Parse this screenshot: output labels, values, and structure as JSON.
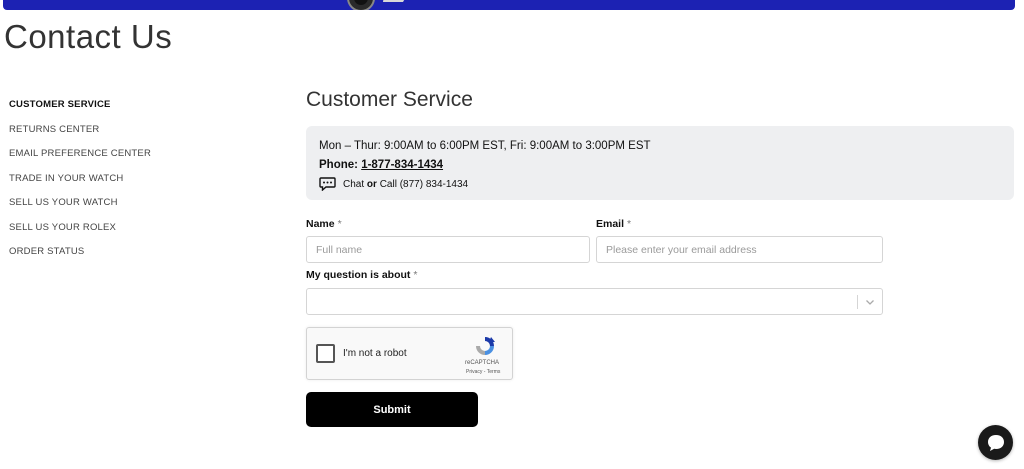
{
  "header": {
    "page_title": "Contact Us"
  },
  "sidebar": {
    "items": [
      {
        "label": "CUSTOMER SERVICE",
        "active": true
      },
      {
        "label": "RETURNS CENTER"
      },
      {
        "label": "EMAIL PREFERENCE CENTER"
      },
      {
        "label": "TRADE IN YOUR WATCH"
      },
      {
        "label": "SELL US YOUR WATCH"
      },
      {
        "label": "SELL US YOUR ROLEX"
      },
      {
        "label": "ORDER STATUS"
      }
    ]
  },
  "main": {
    "section_title": "Customer Service",
    "info": {
      "hours": "Mon – Thur: 9:00AM to 6:00PM EST, Fri: 9:00AM to 3:00PM EST",
      "phone_label": "Phone:",
      "phone_number": "1-877-834-1434",
      "chat_text": "Chat",
      "chat_or": "or",
      "call_text": "Call (877) 834-1434"
    },
    "form": {
      "name_label": "Name",
      "name_placeholder": "Full name",
      "name_value": "",
      "email_label": "Email",
      "email_placeholder": "Please enter your email address",
      "email_value": "",
      "question_label": "My question is about",
      "question_value": "",
      "required_mark": "*",
      "recaptcha_label": "I'm not a robot",
      "recaptcha_brand": "reCAPTCHA",
      "recaptcha_links": "Privacy - Terms",
      "submit_label": "Submit"
    }
  },
  "colors": {
    "banner": "#1c22b3",
    "info_bg": "#eeeff1",
    "button": "#000000"
  },
  "icons": [
    "chat-bubble-icon",
    "chevron-down-icon",
    "recaptcha-logo-icon",
    "chat-launcher-icon"
  ]
}
